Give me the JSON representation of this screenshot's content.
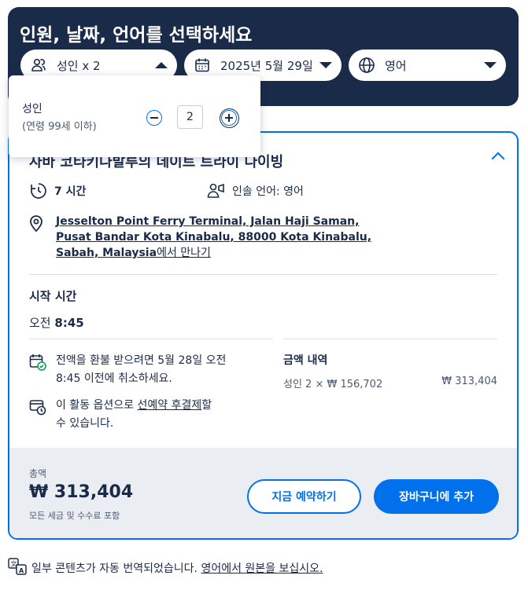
{
  "header": {
    "title": "인원, 날짜, 언어를 선택하세요",
    "participants": "성인 x 2",
    "date": "2025년 5월 29일",
    "language": "영어"
  },
  "popover": {
    "label": "성인",
    "sublabel": "(연령 99세 이하)",
    "count": "2"
  },
  "option": {
    "title": "사바 코타키나발루의 데이트 트라이 다이빙",
    "duration": "7 시간",
    "guide_language": "인솔 언어: 영어",
    "meeting_address_lines": [
      "Jesselton Point Ferry Terminal, Jalan Haji Saman,",
      "Pusat Bandar Kota Kinabalu, 88000 Kota Kinabalu,",
      "Sabah, Malaysia"
    ],
    "meeting_suffix": "에서 만나기",
    "start_label": "시작 시간",
    "start_prefix": "오전",
    "start_time": "8:45",
    "cancel_line1": "전액을 환불 받으려면 5월 28일 오전",
    "cancel_line2": "8:45 이전에 취소하세요.",
    "reserve_prefix": "이 활동 옵션으로",
    "reserve_link": "선예약 후결제",
    "reserve_suffix": "할",
    "reserve_line2": "수 있습니다.",
    "price_heading": "금액 내역",
    "price_breakdown": "성인 2 × ₩ 156,702",
    "price_subtotal": "₩ 313,404"
  },
  "footer": {
    "total_label": "총액",
    "total_amount": "₩ 313,404",
    "total_note": "모든 세금 및 수수료 포함",
    "book_now": "지금 예약하기",
    "add_to_cart": "장바구니에 추가"
  },
  "notice": {
    "text": "일부 콘텐츠가 자동 번역되었습니다.",
    "link": "영어에서 원본을 보십시오."
  },
  "colors": {
    "navy": "#1a2b49",
    "accent": "#0071eb",
    "success": "#0f9d58"
  }
}
